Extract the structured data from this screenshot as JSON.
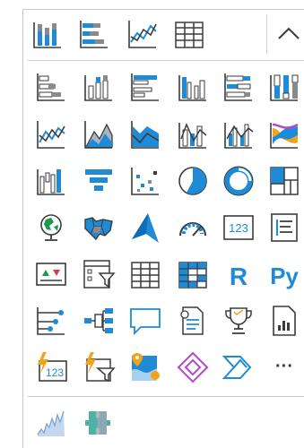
{
  "pinned": [
    {
      "name": "stacked-column-chart-icon"
    },
    {
      "name": "stacked-bar-chart-icon"
    },
    {
      "name": "line-chart-icon"
    },
    {
      "name": "table-icon"
    }
  ],
  "collapse_button": {
    "icon": "chevron-up-icon"
  },
  "visuals": [
    {
      "name": "stacked-bar-chart-icon"
    },
    {
      "name": "stacked-column-chart-icon"
    },
    {
      "name": "clustered-bar-chart-icon"
    },
    {
      "name": "clustered-column-chart-icon"
    },
    {
      "name": "100-stacked-bar-chart-icon"
    },
    {
      "name": "100-stacked-column-chart-icon"
    },
    {
      "name": "line-chart-icon"
    },
    {
      "name": "area-chart-icon"
    },
    {
      "name": "stacked-area-chart-icon"
    },
    {
      "name": "line-and-stacked-column-chart-icon"
    },
    {
      "name": "line-and-clustered-column-chart-icon"
    },
    {
      "name": "ribbon-chart-icon"
    },
    {
      "name": "waterfall-chart-icon"
    },
    {
      "name": "funnel-icon"
    },
    {
      "name": "scatter-chart-icon"
    },
    {
      "name": "pie-chart-icon"
    },
    {
      "name": "donut-chart-icon"
    },
    {
      "name": "treemap-icon"
    },
    {
      "name": "map-icon"
    },
    {
      "name": "filled-map-icon"
    },
    {
      "name": "azure-map-icon"
    },
    {
      "name": "gauge-icon"
    },
    {
      "name": "card-icon",
      "text": "123"
    },
    {
      "name": "multi-row-card-icon"
    },
    {
      "name": "kpi-icon"
    },
    {
      "name": "slicer-icon"
    },
    {
      "name": "table-icon"
    },
    {
      "name": "matrix-icon"
    },
    {
      "name": "r-script-visual-icon",
      "text": "R"
    },
    {
      "name": "python-visual-icon",
      "text": "Py"
    },
    {
      "name": "key-influencers-icon"
    },
    {
      "name": "decomposition-tree-icon"
    },
    {
      "name": "qa-icon"
    },
    {
      "name": "smart-narrative-icon"
    },
    {
      "name": "metrics-icon"
    },
    {
      "name": "paginated-report-icon"
    },
    {
      "name": "power-apps-card-icon",
      "text": "123"
    },
    {
      "name": "power-apps-slicer-icon"
    },
    {
      "name": "arcgis-map-icon"
    },
    {
      "name": "power-apps-icon"
    },
    {
      "name": "power-automate-icon"
    },
    {
      "name": "more-visuals-icon",
      "text": "···"
    }
  ],
  "custom": [
    {
      "name": "custom-line-visual-icon"
    },
    {
      "name": "custom-puzzle-visual-icon"
    }
  ],
  "colors": {
    "blue": "#1f8ad6",
    "dark": "#3b3b3b",
    "grey": "#8a8a8a",
    "purple": "#b34bc9",
    "orange": "#f2a31c"
  }
}
